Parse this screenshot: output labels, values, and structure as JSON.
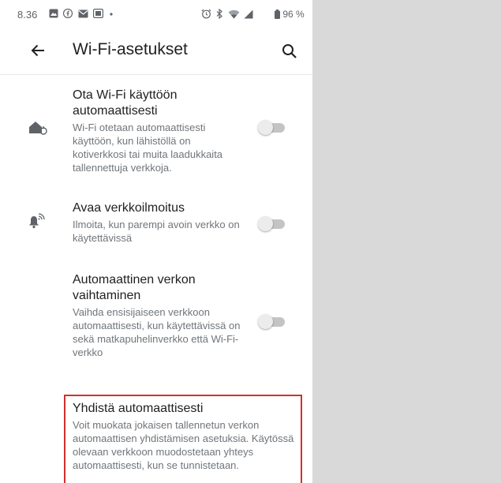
{
  "status_bar": {
    "time": "8.36",
    "battery": "96 %",
    "notification_icons": [
      "gallery-icon",
      "facebook-icon",
      "mail-icon",
      "image-icon",
      "dot-icon"
    ],
    "system_icons": [
      "alarm-icon",
      "bluetooth-icon",
      "wifi-icon",
      "cellular-signal-icon",
      "battery-icon"
    ]
  },
  "app_bar": {
    "title": "Wi-Fi-asetukset",
    "back_icon": "arrow-back-icon",
    "search_icon": "search-icon"
  },
  "settings": [
    {
      "title": "Ota Wi-Fi käyttöön automaattisesti",
      "description": "Wi-Fi otetaan automaattisesti käyttöön, kun lähistöllä on kotiverkkosi tai muita laadukkaita tallennettuja verkkoja.",
      "icon": "home-wifi-icon",
      "enabled": false
    },
    {
      "title": "Avaa verkkoilmoitus",
      "description": "Ilmoita, kun parempi avoin verkko on käytettävissä",
      "icon": "notification-wifi-icon",
      "enabled": false
    },
    {
      "title": "Automaattinen verkon vaihtaminen",
      "description": "Vaihda ensisijaiseen verkkoon automaattisesti, kun käytettävissä on sekä matkapuhelinverkko että Wi-Fi-verkko",
      "icon": "",
      "enabled": false
    }
  ],
  "highlight": {
    "title": "Yhdistä automaattisesti",
    "description": "Voit muokata jokaisen tallennetun verkon automaattisen yhdistämisen asetuksia. Käytössä olevaan verkkoon muodostetaan yhteys automaattisesti, kun se tunnistetaan.",
    "border_color": "#d32f2f"
  },
  "colors": {
    "background": "#d9d9d9",
    "surface": "#ffffff",
    "primary_text": "#202124",
    "secondary_text": "#70757a",
    "toggle_off_track": "#c4c4c4"
  }
}
